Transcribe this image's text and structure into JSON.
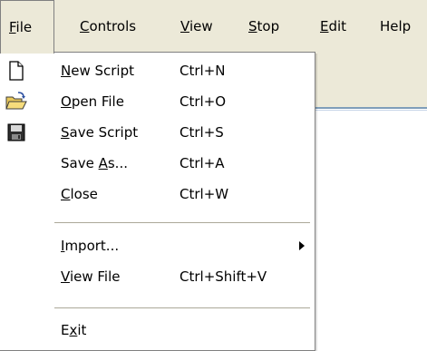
{
  "menubar": {
    "items": [
      {
        "pre": "",
        "u": "F",
        "post": "ile"
      },
      {
        "pre": "",
        "u": "C",
        "post": "ontrols"
      },
      {
        "pre": "",
        "u": "V",
        "post": "iew"
      },
      {
        "pre": "",
        "u": "S",
        "post": "top"
      },
      {
        "pre": "",
        "u": "E",
        "post": "dit"
      },
      {
        "pre": "",
        "u": "",
        "post": "Help"
      }
    ]
  },
  "file_menu": {
    "items": [
      {
        "pre": "",
        "u": "N",
        "post": "ew Script",
        "shortcut": "Ctrl+N",
        "icon": "new-document-icon"
      },
      {
        "pre": "",
        "u": "O",
        "post": "pen File",
        "shortcut": "Ctrl+O",
        "icon": "open-folder-icon"
      },
      {
        "pre": "",
        "u": "S",
        "post": "ave Script",
        "shortcut": "Ctrl+S",
        "icon": "save-floppy-icon"
      },
      {
        "pre": "Save ",
        "u": "A",
        "post": "s...",
        "shortcut": "Ctrl+A"
      },
      {
        "pre": "",
        "u": "C",
        "post": "lose",
        "shortcut": "Ctrl+W"
      },
      {
        "pre": "",
        "u": "I",
        "post": "mport...",
        "shortcut": "",
        "submenu_icon": "submenu-arrow-icon"
      },
      {
        "pre": "",
        "u": "V",
        "post": "iew File",
        "shortcut": "Ctrl+Shift+V"
      },
      {
        "pre": "E",
        "u": "x",
        "post": "it",
        "shortcut": ""
      }
    ]
  },
  "colors": {
    "menubar_bg": "#ece9d8",
    "menu_bg": "#ffffff",
    "separator": "#aca899",
    "accent_rule": "#7f9db9"
  }
}
